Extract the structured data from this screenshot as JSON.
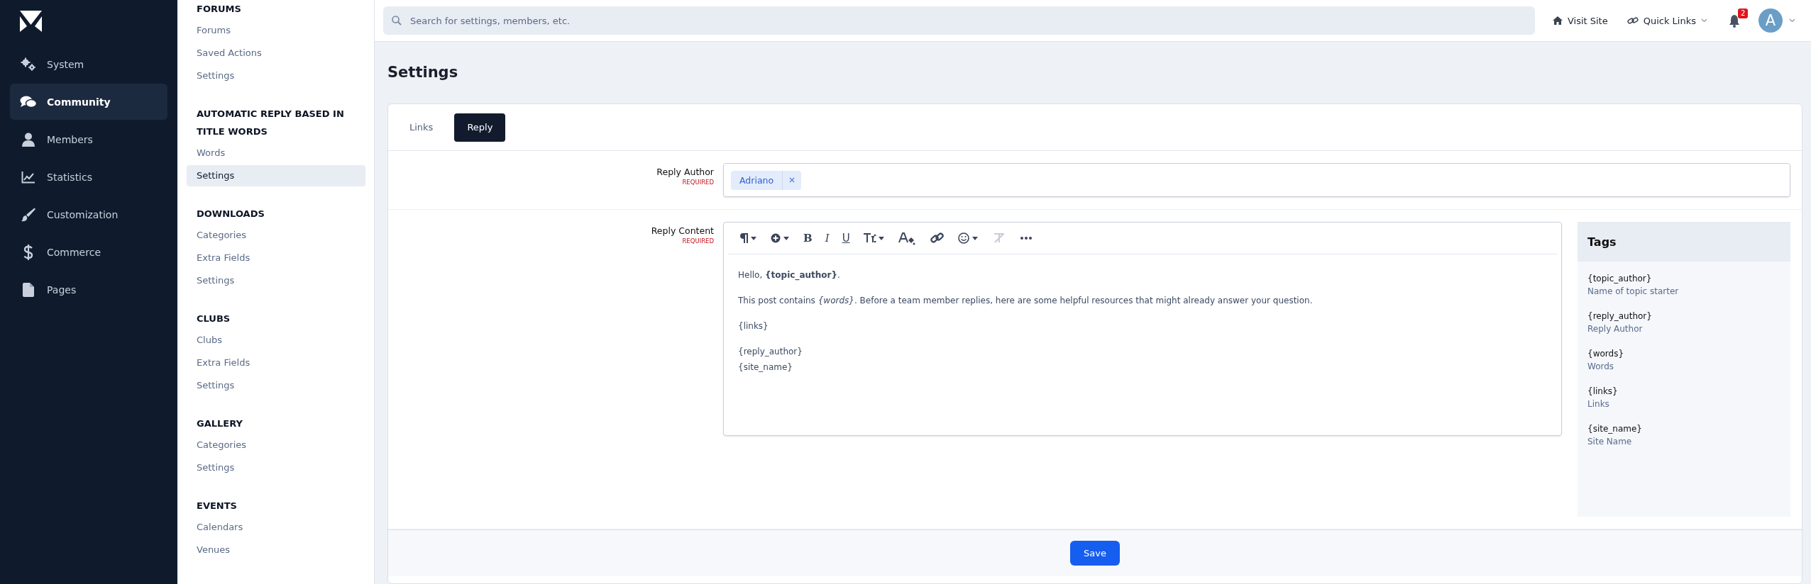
{
  "nav": {
    "items": [
      {
        "label": "System",
        "selected": false
      },
      {
        "label": "Community",
        "selected": true
      },
      {
        "label": "Members",
        "selected": false
      },
      {
        "label": "Statistics",
        "selected": false
      },
      {
        "label": "Customization",
        "selected": false
      },
      {
        "label": "Commerce",
        "selected": false
      },
      {
        "label": "Pages",
        "selected": false
      }
    ]
  },
  "submenu": {
    "sections": [
      {
        "heading": "FORUMS",
        "items": [
          {
            "label": "Forums",
            "selected": false
          },
          {
            "label": "Saved Actions",
            "selected": false
          },
          {
            "label": "Settings",
            "selected": false
          }
        ]
      },
      {
        "heading": "AUTOMATIC REPLY BASED IN TITLE WORDS",
        "items": [
          {
            "label": "Words",
            "selected": false
          },
          {
            "label": "Settings",
            "selected": true
          }
        ]
      },
      {
        "heading": "DOWNLOADS",
        "items": [
          {
            "label": "Categories",
            "selected": false
          },
          {
            "label": "Extra Fields",
            "selected": false
          },
          {
            "label": "Settings",
            "selected": false
          }
        ]
      },
      {
        "heading": "CLUBS",
        "items": [
          {
            "label": "Clubs",
            "selected": false
          },
          {
            "label": "Extra Fields",
            "selected": false
          },
          {
            "label": "Settings",
            "selected": false
          }
        ]
      },
      {
        "heading": "GALLERY",
        "items": [
          {
            "label": "Categories",
            "selected": false
          },
          {
            "label": "Settings",
            "selected": false
          }
        ]
      },
      {
        "heading": "EVENTS",
        "items": [
          {
            "label": "Calendars",
            "selected": false
          },
          {
            "label": "Venues",
            "selected": false
          }
        ]
      }
    ]
  },
  "topbar": {
    "search": {
      "placeholder": "Search for settings, members, etc."
    },
    "visit_site": "Visit Site",
    "quick_links": "Quick Links",
    "notifications": {
      "count": "2"
    },
    "avatar": {
      "initial": "A"
    }
  },
  "page": {
    "title": "Settings",
    "tabs": [
      {
        "label": "Links",
        "selected": false
      },
      {
        "label": "Reply",
        "selected": true
      }
    ],
    "fields": [
      {
        "kind": "tags",
        "label": "Reply Author",
        "required": "REQUIRED",
        "tokens": [
          "Adriano"
        ]
      },
      {
        "kind": "editor",
        "label": "Reply Content",
        "required": "REQUIRED",
        "toolbar": [
          {
            "kind": "paragraph",
            "disabled": false
          },
          {
            "kind": "insert",
            "disabled": false
          },
          {
            "kind": "bold",
            "glyph": "B",
            "disabled": false
          },
          {
            "kind": "italic",
            "glyph": "I",
            "disabled": false
          },
          {
            "kind": "underline",
            "glyph": "U",
            "disabled": false
          },
          {
            "kind": "size",
            "disabled": false
          },
          {
            "kind": "color",
            "disabled": false
          },
          {
            "kind": "link",
            "disabled": false
          },
          {
            "kind": "emoji",
            "disabled": false
          },
          {
            "kind": "clear",
            "disabled": true
          },
          {
            "kind": "more",
            "disabled": false
          }
        ],
        "paragraphs": [
          {
            "lines": [
              "Hello, **{topic_author}**."
            ]
          },
          {
            "lines": [
              "This post contains *{words}*. Before a team member replies, here are some helpful resources that might already answer your question."
            ]
          },
          {
            "lines": [
              "{links}"
            ]
          },
          {
            "lines": [
              "{reply_author}",
              "{site_name}"
            ]
          }
        ],
        "tags_panel": {
          "title": "Tags",
          "tags": [
            {
              "tag": "{topic_author}",
              "description": "Name of topic starter"
            },
            {
              "tag": "{reply_author}",
              "description": "Reply Author"
            },
            {
              "tag": "{words}",
              "description": "Words"
            },
            {
              "tag": "{links}",
              "description": "Links"
            },
            {
              "tag": "{site_name}",
              "description": "Site Name"
            }
          ]
        }
      }
    ],
    "save": "Save"
  }
}
